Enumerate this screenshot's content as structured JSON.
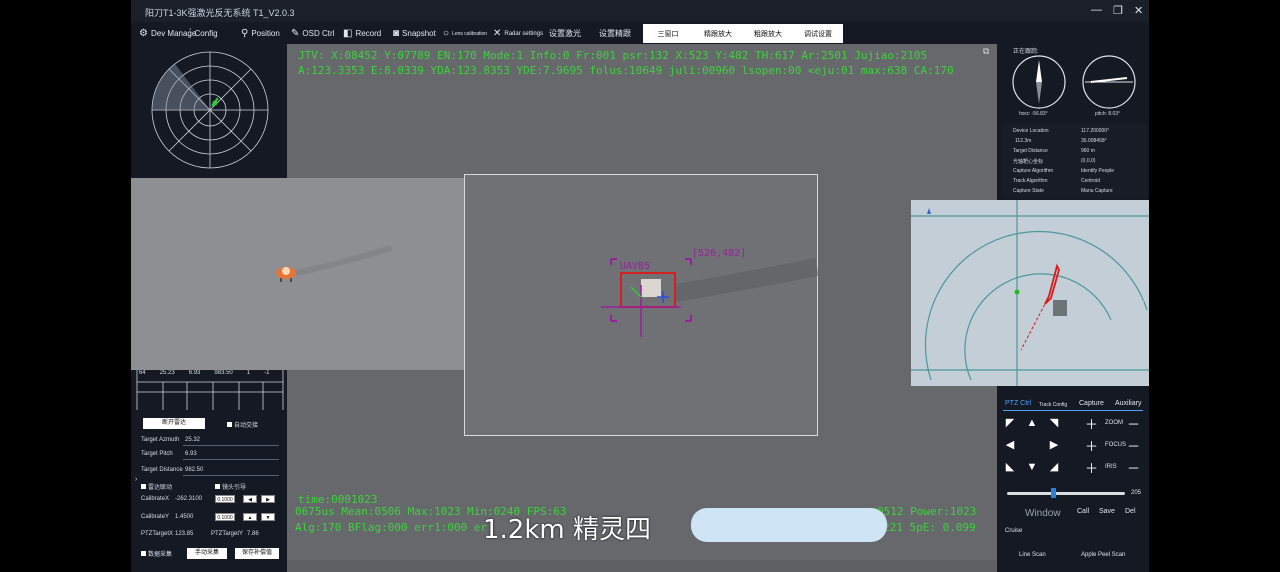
{
  "titlebar": {
    "title": "阳刀T1-3K强激光反无系统 T1_V2.0.3",
    "min": "—",
    "restore": "❐",
    "close": "✕"
  },
  "menu": {
    "dev_manage": "Dev Manage",
    "config": "Config",
    "position": "Position",
    "osd_ctrl": "OSD Ctrl",
    "record": "Record",
    "snapshot": "Snapshot",
    "lens_calibration": "Lens calibration",
    "radar_settings": "Radar settings",
    "set_laser": "设置激光",
    "set_precision": "设置精跟",
    "tabs": [
      "三窗口",
      "精跟放大",
      "粗跟放大",
      "调试设置"
    ]
  },
  "osd": {
    "line1": "JTV: X:08452 Y:07789  EN:170  Mode:1  Info:0 Fr:001  psr:132  X:523  Y:482  TH:617  Ar:2501  Jujiao:2105",
    "line2": "A:123.3353  E:8.0339  YDA:123.8353  YDE:7.9695  folus:10649  juli:00960  lsopen:00  <eju:01  max:638  CA:170",
    "time": "time:0001023",
    "line3": "0675us Mean:0506 Max:1023 Min:0240 FPS:63",
    "line3b": "0512 Power:1023",
    "line4": "Alg:170  BFlag:000  err1:000  er",
    "line4b": "221  5pE: 0.099"
  },
  "overlay": {
    "target_label": "UAV85",
    "coord": "[526,482]"
  },
  "caption": {
    "text": "1.2km 精灵四"
  },
  "left": {
    "stats_row": [
      "64",
      "25.23",
      "6.93",
      "983.50",
      "1",
      "-1"
    ],
    "btn_radar_off": "断开雷达",
    "chk_auto_slew": "自动交接",
    "target_azimuth_label": "Target Azmuth",
    "target_azimuth_val": "25.32",
    "target_pitch_label": "Target Pitch",
    "target_pitch_val": "6.93",
    "target_distance_label": "Target Distance",
    "target_distance_val": "982.50",
    "chk_radar_link": "雷达联动",
    "chk_lens_guide": "镜头引导",
    "calib_x_label": "CalibrateX",
    "calib_x_val": "-262.3100",
    "calib_x_step": "0.1000",
    "calib_y_label": "CalibrateY",
    "calib_y_val": "1.4500",
    "calib_y_step": "0.1000",
    "ptz_target_x_label": "PTZTargetX",
    "ptz_target_x_val": "123.85",
    "ptz_target_y_label": "PTZTargetY",
    "ptz_target_y_val": "7.86",
    "chk_data_collect": "数据采集",
    "btn_manual_collect": "手动采集",
    "btn_save_comp": "保存补偿值"
  },
  "right": {
    "status": "正在跟踪:",
    "horz": "horz: -56.83°",
    "pitch": "pitch: 8.03°",
    "info": [
      {
        "label": "Device Location",
        "value": "117.200000°"
      },
      {
        "label": "112.3m",
        "value": "36.008458°"
      },
      {
        "label": "Target Distance",
        "value": "960 m"
      },
      {
        "label": "光轴靶心坐标",
        "value": "(0,0,0)"
      },
      {
        "label": "Capture Algorithm",
        "value": "Identify People"
      },
      {
        "label": "Track Algorithm",
        "value": "Centroid"
      },
      {
        "label": "Capture State",
        "value": "Manu Capture"
      }
    ]
  },
  "ptz": {
    "tabs": [
      "PTZ Ctrl",
      "Track Config",
      "Capture",
      "Auxiliary"
    ],
    "zoom": "ZOOM",
    "focus": "FOCUS",
    "iris": "IRIS",
    "speed": "205",
    "cruise": "Cruise",
    "call": "Call",
    "save": "Save",
    "del": "Del",
    "line_scan": "Line Scan",
    "apple_peel_scan": "Apple Peel Scan",
    "window": "Window"
  }
}
